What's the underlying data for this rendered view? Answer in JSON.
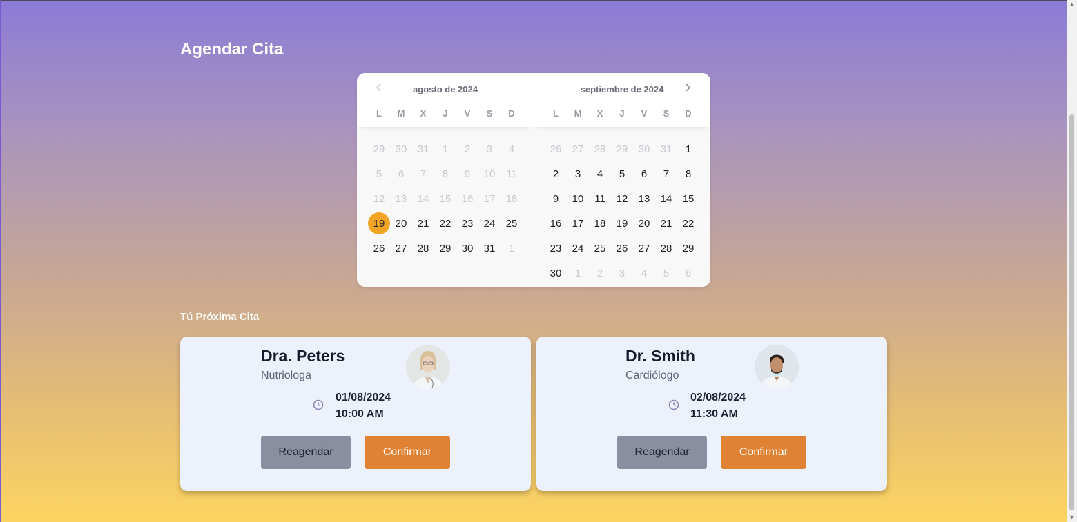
{
  "page": {
    "title": "Agendar Cita",
    "next_section_title": "Tú Próxima Cita"
  },
  "calendar": {
    "months": [
      {
        "title": "agosto de 2024",
        "weekdays": [
          "L",
          "M",
          "X",
          "J",
          "V",
          "S",
          "D"
        ],
        "days": [
          {
            "d": "29",
            "m": true
          },
          {
            "d": "30",
            "m": true
          },
          {
            "d": "31",
            "m": true
          },
          {
            "d": "1",
            "m": true
          },
          {
            "d": "2",
            "m": true
          },
          {
            "d": "3",
            "m": true
          },
          {
            "d": "4",
            "m": true
          },
          {
            "d": "5",
            "m": true
          },
          {
            "d": "6",
            "m": true
          },
          {
            "d": "7",
            "m": true
          },
          {
            "d": "8",
            "m": true
          },
          {
            "d": "9",
            "m": true
          },
          {
            "d": "10",
            "m": true
          },
          {
            "d": "11",
            "m": true
          },
          {
            "d": "12",
            "m": true
          },
          {
            "d": "13",
            "m": true
          },
          {
            "d": "14",
            "m": true
          },
          {
            "d": "15",
            "m": true
          },
          {
            "d": "16",
            "m": true
          },
          {
            "d": "17",
            "m": true
          },
          {
            "d": "18",
            "m": true
          },
          {
            "d": "19",
            "sel": true
          },
          {
            "d": "20"
          },
          {
            "d": "21"
          },
          {
            "d": "22"
          },
          {
            "d": "23"
          },
          {
            "d": "24"
          },
          {
            "d": "25"
          },
          {
            "d": "26"
          },
          {
            "d": "27"
          },
          {
            "d": "28"
          },
          {
            "d": "29"
          },
          {
            "d": "30"
          },
          {
            "d": "31"
          },
          {
            "d": "1",
            "m": true
          }
        ]
      },
      {
        "title": "septiembre de 2024",
        "weekdays": [
          "L",
          "M",
          "X",
          "J",
          "V",
          "S",
          "D"
        ],
        "days": [
          {
            "d": "26",
            "m": true
          },
          {
            "d": "27",
            "m": true
          },
          {
            "d": "28",
            "m": true
          },
          {
            "d": "29",
            "m": true
          },
          {
            "d": "30",
            "m": true
          },
          {
            "d": "31",
            "m": true
          },
          {
            "d": "1"
          },
          {
            "d": "2"
          },
          {
            "d": "3"
          },
          {
            "d": "4"
          },
          {
            "d": "5"
          },
          {
            "d": "6"
          },
          {
            "d": "7"
          },
          {
            "d": "8"
          },
          {
            "d": "9"
          },
          {
            "d": "10"
          },
          {
            "d": "11"
          },
          {
            "d": "12"
          },
          {
            "d": "13"
          },
          {
            "d": "14"
          },
          {
            "d": "15"
          },
          {
            "d": "16"
          },
          {
            "d": "17"
          },
          {
            "d": "18"
          },
          {
            "d": "19"
          },
          {
            "d": "20"
          },
          {
            "d": "21"
          },
          {
            "d": "22"
          },
          {
            "d": "23"
          },
          {
            "d": "24"
          },
          {
            "d": "25"
          },
          {
            "d": "26"
          },
          {
            "d": "27"
          },
          {
            "d": "28"
          },
          {
            "d": "29"
          },
          {
            "d": "30"
          },
          {
            "d": "1",
            "m": true
          },
          {
            "d": "2",
            "m": true
          },
          {
            "d": "3",
            "m": true
          },
          {
            "d": "4",
            "m": true
          },
          {
            "d": "5",
            "m": true
          },
          {
            "d": "6",
            "m": true
          }
        ]
      }
    ],
    "prev_icon": "chevron-left-icon",
    "next_icon": "chevron-right-icon",
    "selected_color": "#f2a523"
  },
  "appointments": [
    {
      "doctor": "Dra. Peters",
      "specialty": "Nutriologa",
      "date": "01/08/2024",
      "time": "10:00 AM",
      "reschedule_label": "Reagendar",
      "confirm_label": "Confirmar"
    },
    {
      "doctor": "Dr. Smith",
      "specialty": "Cardiólogo",
      "date": "02/08/2024",
      "time": "11:30 AM",
      "reschedule_label": "Reagendar",
      "confirm_label": "Confirmar"
    }
  ],
  "colors": {
    "confirm": "#e08233",
    "reschedule": "#8a8fa0",
    "card_bg": "#edf1fb"
  }
}
